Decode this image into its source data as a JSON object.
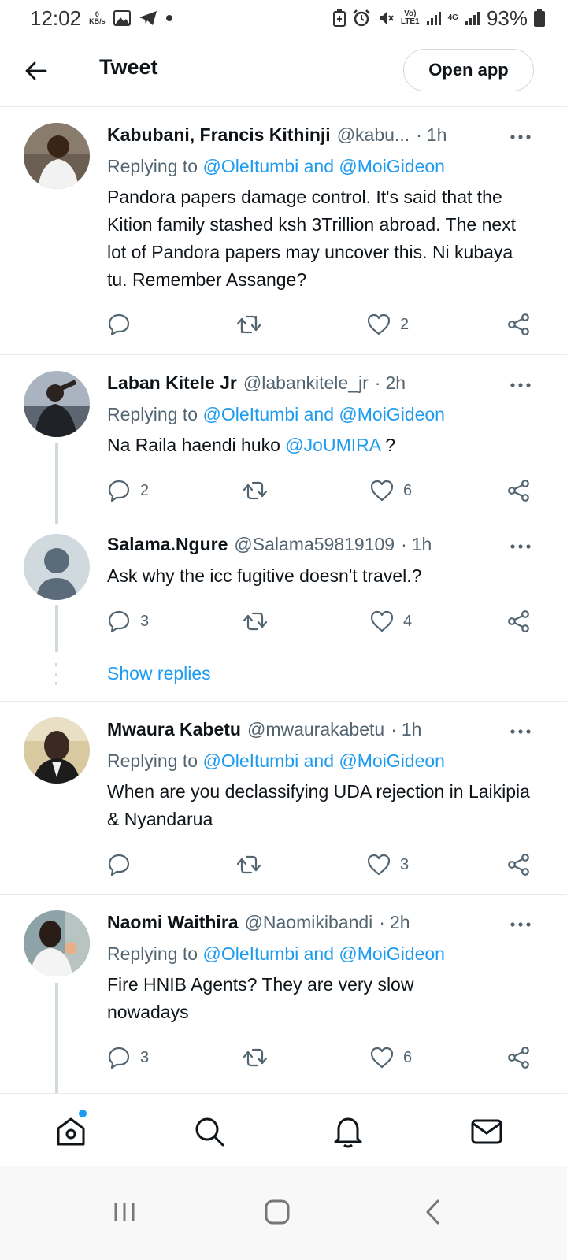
{
  "status_bar": {
    "time": "12:02",
    "net_speed": "0",
    "net_unit": "KB/s",
    "volte": "Vo)",
    "lte": "LTE1",
    "net_gen": "4G",
    "battery": "93%",
    "icons": [
      "image-icon",
      "telegram-icon",
      "dot-icon",
      "battery-saver-icon",
      "alarm-icon",
      "mute-icon",
      "signal-icon",
      "battery-icon"
    ]
  },
  "app_bar": {
    "title": "Tweet",
    "open_app_label": "Open app"
  },
  "replying_prefix": "Replying to ",
  "replying_to": "@OleItumbi and @MoiGideon",
  "show_replies": "Show replies",
  "tweets": [
    {
      "name": "Kabubani, Francis Kithinji",
      "handle": "@kabu...",
      "time": "1h",
      "text": "Pandora papers damage control. It's said that the Kition family stashed ksh 3Trillion abroad. The next lot of Pandora papers may uncover this. Ni kubaya tu. Remember Assange?",
      "replies": "",
      "retweets": "",
      "likes": "2"
    },
    {
      "name": "Laban Kitele Jr",
      "handle": "@labankitele_jr",
      "time": "2h",
      "text_before": "Na Raila haendi huko ",
      "text_mention": "@JoUMIRA",
      "text_after": " ?",
      "replies": "2",
      "retweets": "",
      "likes": "6"
    },
    {
      "name": "Salama.Ngure",
      "handle": "@Salama59819109",
      "time": "1h",
      "text": "Ask why the icc fugitive doesn't travel.?",
      "replies": "3",
      "retweets": "",
      "likes": "4"
    },
    {
      "name": "Mwaura Kabetu",
      "handle": "@mwaurakabetu",
      "time": "1h",
      "text": "When are you declassifying UDA rejection in Laikipia & Nyandarua",
      "replies": "",
      "retweets": "",
      "likes": "3"
    },
    {
      "name": "Naomi Waithira",
      "handle": "@Naomikibandi",
      "time": "2h",
      "text": "Fire HNIB Agents? They are very slow nowadays",
      "replies": "3",
      "retweets": "",
      "likes": "6"
    }
  ],
  "colors": {
    "accent": "#1d9bf0",
    "text": "#0f1419",
    "secondary": "#536471",
    "border": "#e7e9ea",
    "thread": "#cfd9de"
  }
}
